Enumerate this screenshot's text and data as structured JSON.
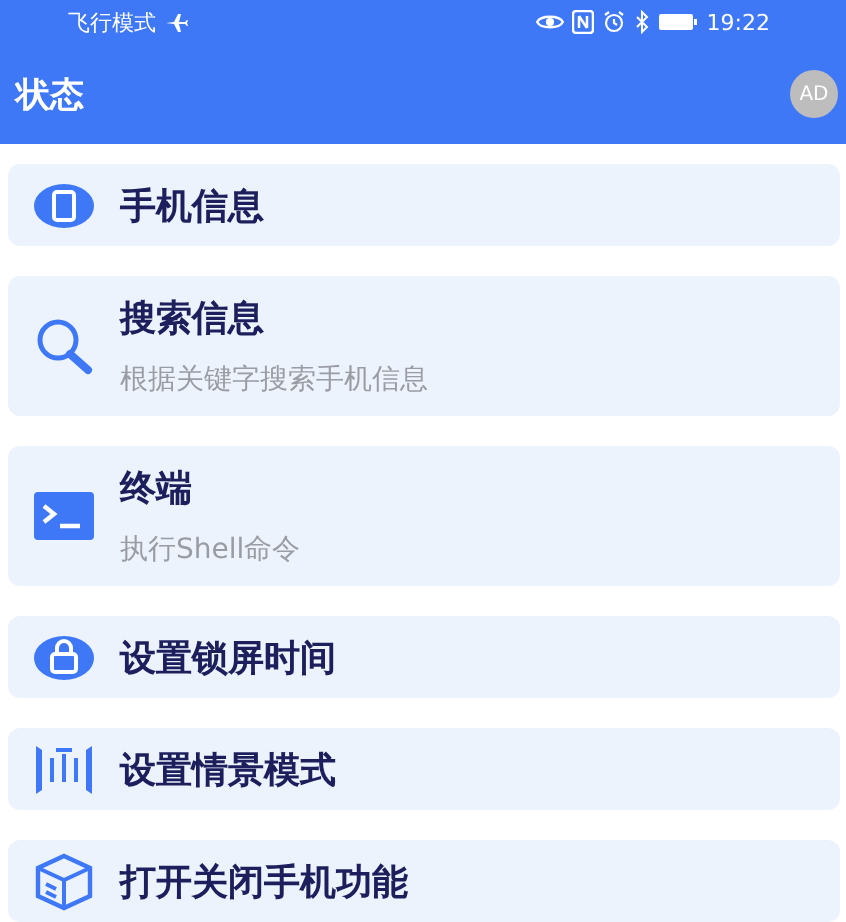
{
  "status_bar": {
    "mode": "飞行模式",
    "time": "19:22"
  },
  "app_bar": {
    "title": "状态",
    "avatar": "AD"
  },
  "items": [
    {
      "kind": "phone",
      "title": "手机信息"
    },
    {
      "kind": "search",
      "title": "搜索信息",
      "subtitle": "根据关键字搜索手机信息"
    },
    {
      "kind": "terminal",
      "title": "终端",
      "subtitle": "执行Shell命令"
    },
    {
      "kind": "lock",
      "title": "设置锁屏时间"
    },
    {
      "kind": "scene",
      "title": "设置情景模式"
    },
    {
      "kind": "box",
      "title": "打开关闭手机功能"
    }
  ]
}
